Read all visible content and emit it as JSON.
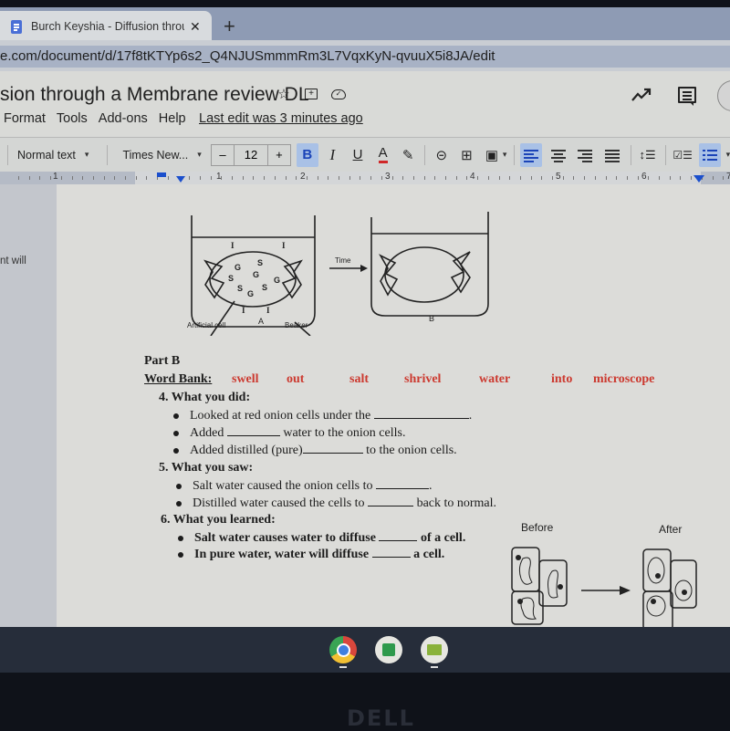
{
  "browser": {
    "tab_title": "Burch Keyshia - Diffusion throug",
    "tab_close": "✕",
    "new_tab": "+",
    "url": "e.com/document/d/17f8tKTYp6s2_Q4NJUSmmmRm3L7VqxKyN-qvuuX5i8JA/edit"
  },
  "docs": {
    "title": "sion through a Membrane review DL",
    "title_icons": [
      "star-icon",
      "move-to-folder-icon",
      "cloud-status-icon"
    ],
    "menu": [
      "Format",
      "Tools",
      "Add-ons",
      "Help"
    ],
    "last_edit": "Last edit was 3 minutes ago"
  },
  "toolbar": {
    "style": "Normal text",
    "font": "Times New...",
    "font_size_dec": "–",
    "font_size": "12",
    "font_size_inc": "+",
    "bold": "B",
    "italic": "I",
    "underline": "U",
    "text_color": "A",
    "highlight": "✎",
    "link": "⊝",
    "comment": "⊞",
    "image": "▣",
    "line_spacing": "↕☰",
    "checklist": "☑☰",
    "caret": "▾"
  },
  "ruler": {
    "numbers": [
      "1",
      "1",
      "2",
      "3",
      "4",
      "5",
      "6",
      "7"
    ]
  },
  "outline_snippet": "nt will",
  "diagram": {
    "time_label": "Time",
    "beaker_a_solutes": [
      "G",
      "S",
      "S",
      "G",
      "S",
      "S",
      "G",
      "G",
      "S",
      "G"
    ],
    "outside_labels": [
      "I",
      "I",
      "I",
      "I"
    ],
    "label_artificial_cell": "Artificial cell",
    "label_a": "A",
    "label_beaker": "Beaker",
    "label_b": "B"
  },
  "worksheet": {
    "part": "Part B",
    "word_bank_label": "Word Bank:",
    "word_bank": [
      "swell",
      "out",
      "salt",
      "shrivel",
      "water",
      "into",
      "microscope"
    ],
    "word_bank_color": "#cc3a30",
    "q4": {
      "title": "4.  What you did:",
      "items": [
        {
          "before": "Looked at red onion cells under the",
          "after": "."
        },
        {
          "before": "Added",
          "after": "water to the onion cells."
        },
        {
          "before": "Added distilled (pure)",
          "after": "to the onion cells."
        }
      ]
    },
    "q5": {
      "title": "5.  What you saw:",
      "items": [
        {
          "before": "Salt water caused the onion cells to",
          "after": "."
        },
        {
          "before": "Distilled water caused the cells to",
          "after": "back to normal."
        }
      ]
    },
    "q6": {
      "title": "6.  What you learned:",
      "items": [
        {
          "before": "Salt water causes water to diffuse",
          "after": "of a cell."
        },
        {
          "before": "In pure water, water will diffuse",
          "after": "a cell."
        }
      ]
    },
    "cells_before": "Before",
    "cells_after": "After"
  },
  "shelf": [
    "chrome-icon",
    "app-icon",
    "classroom-icon"
  ],
  "bezel_logo": "DELL"
}
